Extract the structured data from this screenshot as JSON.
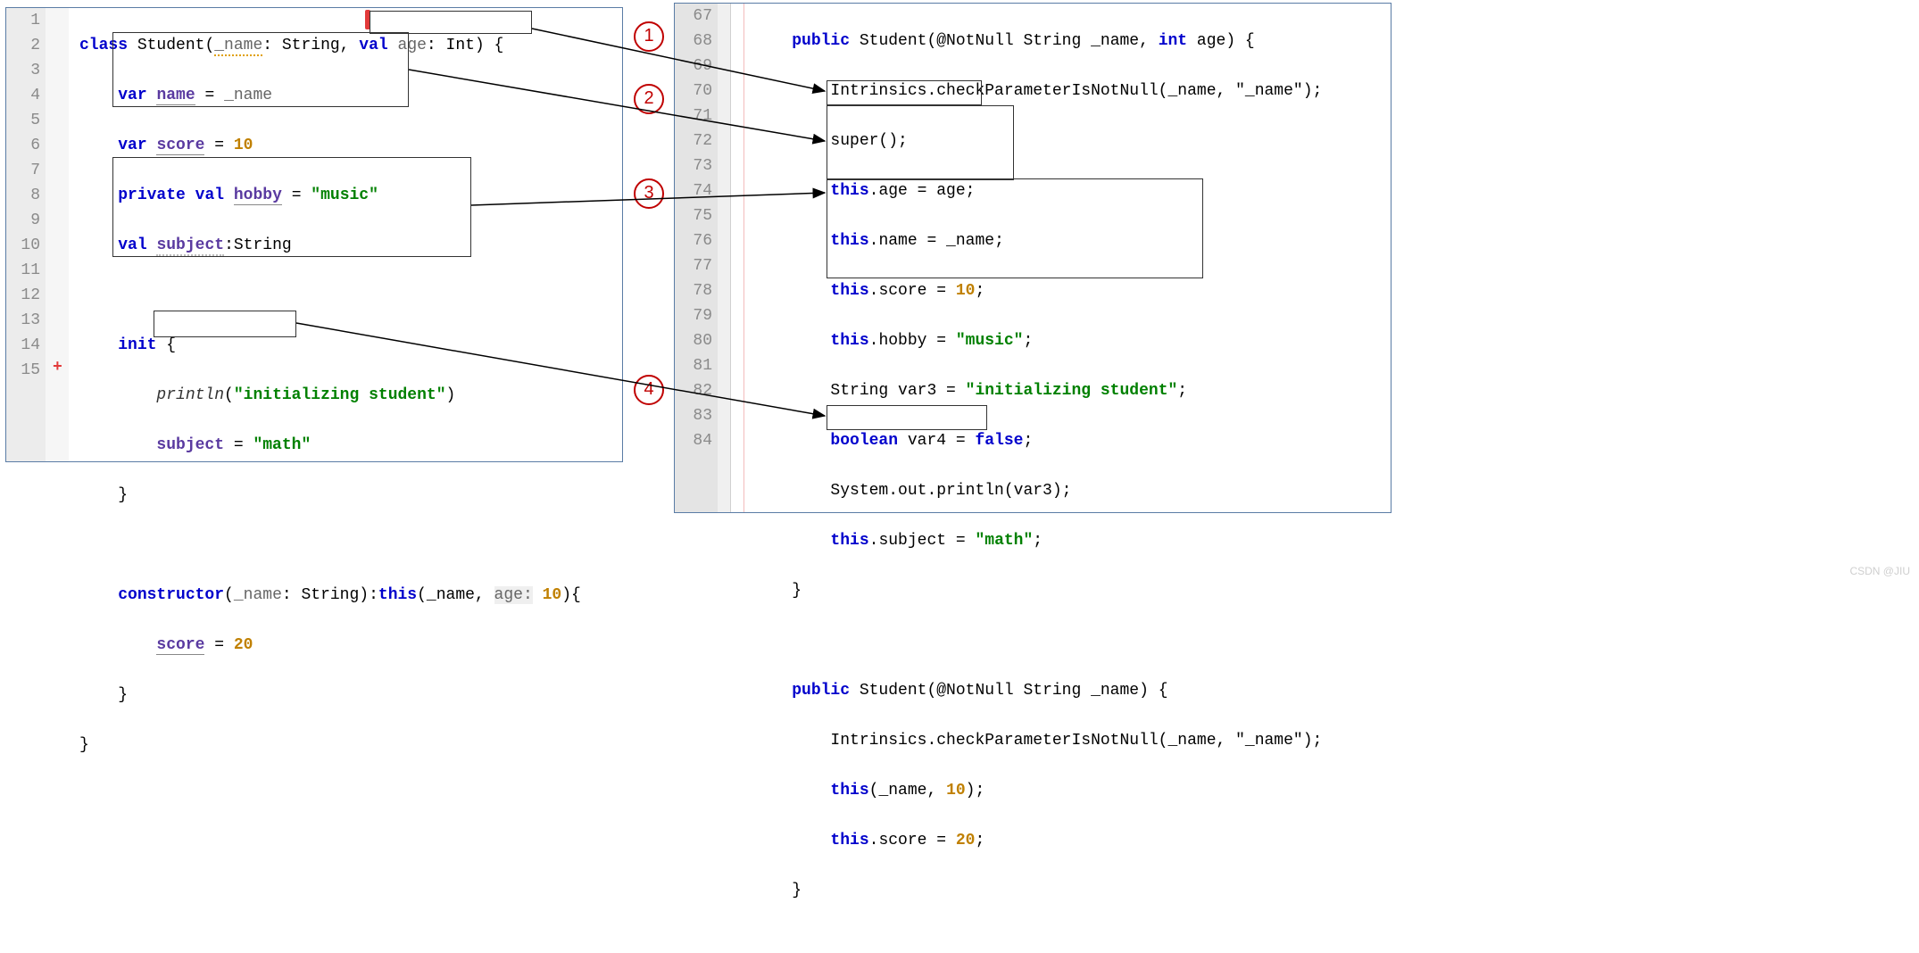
{
  "left": {
    "line_numbers": [
      "1",
      "2",
      "3",
      "4",
      "5",
      "6",
      "7",
      "8",
      "9",
      "10",
      "11",
      "12",
      "13",
      "14",
      "15"
    ],
    "code": {
      "l1": {
        "kw1": "class",
        "sp": " ",
        "t1": "Student(",
        "p1": "_name",
        "t2": ": String, ",
        "kw2": "val",
        "sp2": " ",
        "p2": "age",
        "t3": ": Int) {"
      },
      "l2": {
        "kw": "var",
        "sp": " ",
        "id": "name",
        "eq": " = ",
        "v": "_name"
      },
      "l3": {
        "kw": "var",
        "sp": " ",
        "id": "score",
        "eq": " = ",
        "num": "10"
      },
      "l4": {
        "kw1": "private",
        "sp1": " ",
        "kw2": "val",
        "sp2": " ",
        "id": "hobby",
        "eq": " = ",
        "str": "\"music\""
      },
      "l5": {
        "kw": "val",
        "sp": " ",
        "id": "subject",
        "t": ":String"
      },
      "l6": "",
      "l7": {
        "kw": "init",
        "t": " {"
      },
      "l8": {
        "fn": "println",
        "t1": "(",
        "str": "\"initializing student\"",
        "t2": ")"
      },
      "l9": {
        "id": "subject",
        "eq": " = ",
        "str": "\"math\""
      },
      "l10": "}",
      "l11": "",
      "l12": {
        "kw": "constructor",
        "t1": "(",
        "p": "_name",
        "t2": ": String):",
        "kw2": "this",
        "t3": "(_name, ",
        "p2": "age:",
        "sp": " ",
        "num": "10",
        "t4": "){"
      },
      "l13": {
        "id": "score",
        "eq": " = ",
        "num": "20"
      },
      "l14": "}",
      "l15": "}"
    }
  },
  "right": {
    "line_numbers": [
      "67",
      "68",
      "69",
      "70",
      "71",
      "72",
      "73",
      "74",
      "75",
      "76",
      "77",
      "78",
      "79",
      "80",
      "81",
      "82",
      "83",
      "84"
    ],
    "code": {
      "l67": {
        "kw": "public",
        "sp": " ",
        "t1": "Student(@NotNull String _name, ",
        "kw2": "int",
        "t2": " age) {"
      },
      "l68": "Intrinsics.checkParameterIsNotNull(_name, \"_name\");",
      "l69": "super();",
      "l70": {
        "kw": "this",
        "t": ".age = age;"
      },
      "l71": {
        "kw": "this",
        "t": ".name = _name;"
      },
      "l72": {
        "kw": "this",
        "t1": ".score = ",
        "num": "10",
        "t2": ";"
      },
      "l73": {
        "kw": "this",
        "t1": ".hobby = ",
        "str": "\"music\"",
        "t2": ";"
      },
      "l74": {
        "t1": "String var3 = ",
        "str": "\"initializing student\"",
        "t2": ";"
      },
      "l75": {
        "kw": "boolean",
        "t1": " var4 = ",
        "kw2": "false",
        "t2": ";"
      },
      "l76": "System.out.println(var3);",
      "l77": {
        "kw": "this",
        "t1": ".subject = ",
        "str": "\"math\"",
        "t2": ";"
      },
      "l78": "}",
      "l79": "",
      "l80": {
        "kw": "public",
        "t": " Student(@NotNull String _name) {"
      },
      "l81": "Intrinsics.checkParameterIsNotNull(_name, \"_name\");",
      "l82": {
        "kw": "this",
        "t1": "(_name, ",
        "num": "10",
        "t2": ");"
      },
      "l83": {
        "kw": "this",
        "t1": ".score = ",
        "num": "20",
        "t2": ";"
      },
      "l84": "}"
    }
  },
  "annotations": {
    "c1": "1",
    "c2": "2",
    "c3": "3",
    "c4": "4"
  },
  "plus": "+",
  "watermark": "CSDN @JIU"
}
